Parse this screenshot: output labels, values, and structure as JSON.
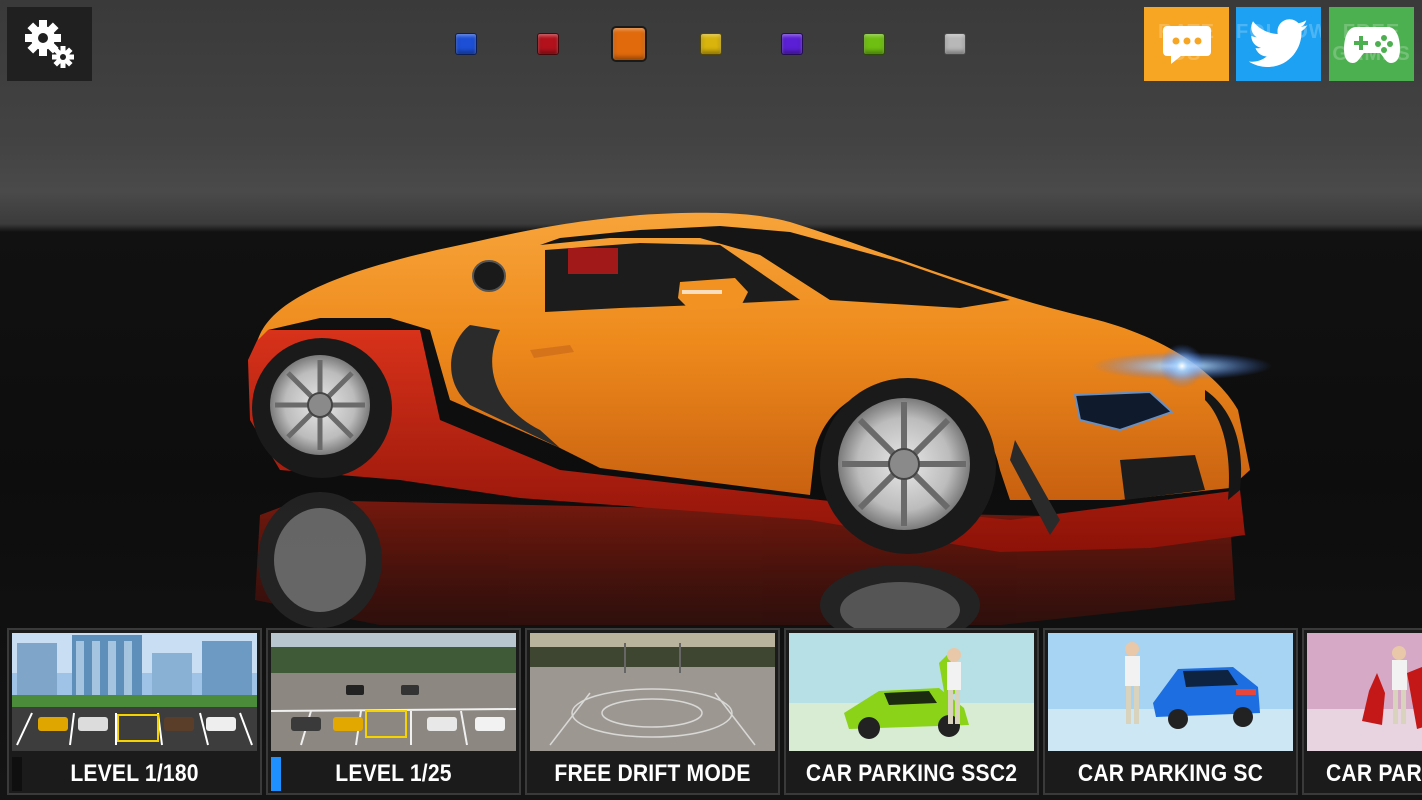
{
  "toolbar": {
    "settings_icon": "gear-icon",
    "color_swatches": [
      {
        "name": "blue",
        "color": "#1c4fd6",
        "selected": false
      },
      {
        "name": "red",
        "color": "#b3121c",
        "selected": false
      },
      {
        "name": "orange",
        "color": "#e06a0c",
        "selected": true
      },
      {
        "name": "yellow",
        "color": "#d8b40c",
        "selected": false
      },
      {
        "name": "purple",
        "color": "#5b1fd6",
        "selected": false
      },
      {
        "name": "green",
        "color": "#6fbf12",
        "selected": false
      },
      {
        "name": "silver",
        "color": "#b8b8b8",
        "selected": false
      }
    ]
  },
  "social": {
    "rate": {
      "ghost_text": "RATE US",
      "color": "#f6a623",
      "icon": "chat-icon"
    },
    "follow": {
      "ghost_text": "FOLLOW",
      "color": "#1da1f2",
      "icon": "twitter-icon"
    },
    "free_games": {
      "ghost_text": "FREE GAMES",
      "color": "#4caf50",
      "icon": "gamepad-icon"
    }
  },
  "levels": [
    {
      "label": "LEVEL 1/180",
      "progress": 0.0
    },
    {
      "label": "LEVEL 1/25",
      "progress": 1.0
    },
    {
      "label": "FREE DRIFT MODE"
    },
    {
      "label": "CAR PARKING SSC2"
    },
    {
      "label": "CAR PARKING SC"
    },
    {
      "label": "CAR PAR"
    }
  ],
  "colors": {
    "car_body": "#f08a1a",
    "car_lower": "#c81e10",
    "progress_accent": "#1e90ff"
  }
}
